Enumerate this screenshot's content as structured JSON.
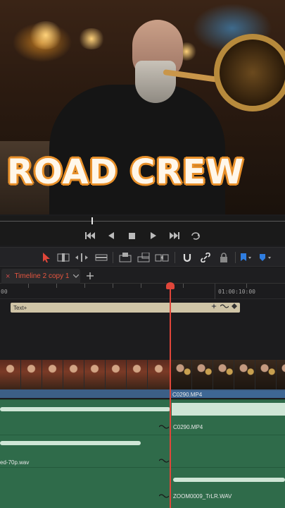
{
  "viewer": {
    "overlay_title": "ROAD CREW"
  },
  "timeline_tab": {
    "label": "Timeline 2 copy 1"
  },
  "ruler": {
    "tc_start": "00",
    "tc_mid": "01:00:10:00"
  },
  "tracks": {
    "title_clip": "Text+",
    "video_clip": "C0290.MP4",
    "audio1_clip": "C0290.MP4",
    "audio2_clip": "ed-70p.wav",
    "audio3_clip": "ZOOM0009_TrLR.WAV"
  },
  "colors": {
    "accent": "#e0463a",
    "video": "#3c5f86",
    "audio": "#2f6b4a",
    "title": "#cfc4a6"
  },
  "icons": [
    "previous-clip-icon",
    "step-back-icon",
    "stop-icon",
    "play-icon",
    "next-clip-icon",
    "loop-icon",
    "select-arrow-icon",
    "trim-icon",
    "dynamic-trim-icon",
    "blade-icon",
    "insert-icon",
    "overwrite-icon",
    "replace-icon",
    "snapping-icon",
    "link-icon",
    "lock-icon",
    "flag-icon",
    "marker-icon"
  ]
}
